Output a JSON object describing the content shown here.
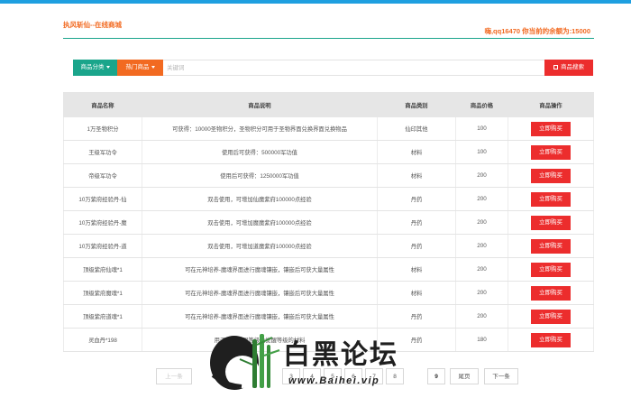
{
  "header": {
    "site_title": "执风斩仙--在线商城",
    "user_info": "嗨,qq16470 你当前的余额为:15000"
  },
  "search": {
    "category_label": "商品分类",
    "hot_label": "热门商品",
    "placeholder": "关键词",
    "button_label": "商品搜索"
  },
  "table": {
    "headers": [
      "商品名称",
      "商品说明",
      "商品类别",
      "商品价格",
      "商品操作"
    ],
    "rows": [
      {
        "name": "1万圣物积分",
        "desc": "可获得：10000圣物积分，圣物积分可用于圣物界面兑换界面兑换物品",
        "category": "仙印其他",
        "price": "100",
        "action": "立即购买"
      },
      {
        "name": "王级军功令",
        "desc": "使用后可获得：500000军功值",
        "category": "材料",
        "price": "100",
        "action": "立即购买"
      },
      {
        "name": "帝级军功令",
        "desc": "使用后可获得：1250000军功值",
        "category": "材料",
        "price": "200",
        "action": "立即购买"
      },
      {
        "name": "10万紫府经验丹-仙",
        "desc": "双击使用，可增加仙魔紫府100000点经验",
        "category": "丹药",
        "price": "200",
        "action": "立即购买"
      },
      {
        "name": "10万紫府经验丹-魔",
        "desc": "双击使用，可增加魔魔紫府100000点经验",
        "category": "丹药",
        "price": "200",
        "action": "立即购买"
      },
      {
        "name": "10万紫府经验丹-道",
        "desc": "双击使用，可增加道魔紫府100000点经验",
        "category": "丹药",
        "price": "200",
        "action": "立即购买"
      },
      {
        "name": "顶级紫府仙魂*1",
        "desc": "可在元神培养-魔魂界面进行魔魂镶嵌，镶嵌后可获大量属性",
        "category": "材料",
        "price": "200",
        "action": "立即购买"
      },
      {
        "name": "顶级紫府魔魂*1",
        "desc": "可在元神培养-魔魂界面进行魔魂镶嵌，镶嵌后可获大量属性",
        "category": "材料",
        "price": "200",
        "action": "立即购买"
      },
      {
        "name": "顶级紫府道魂*1",
        "desc": "可在元神培养-魔魂界面进行魔魂镶嵌，镶嵌后可获大量属性",
        "category": "丹药",
        "price": "200",
        "action": "立即购买"
      },
      {
        "name": "灵血丹*198",
        "desc": "用于提升觉醒等级及觉醒等级的材料",
        "category": "丹药",
        "price": "180",
        "action": "立即购买"
      }
    ]
  },
  "pagination": {
    "prev": "上一条",
    "pages": [
      "3",
      "4",
      "5",
      "6",
      "7",
      "8",
      "9"
    ],
    "last": "尾页",
    "next": "下一条"
  },
  "watermark": {
    "text": "白黑论坛",
    "url": "www.Baihei.vip"
  },
  "colors": {
    "top_bar": "#1e9fe0",
    "accent_orange": "#f26a21",
    "accent_teal": "#1aa58b",
    "buy_red": "#ec2d2d",
    "header_row": "#e6e6e6"
  },
  "icons": {
    "search_button": "square-icon",
    "dropdown": "caret-down-icon"
  }
}
